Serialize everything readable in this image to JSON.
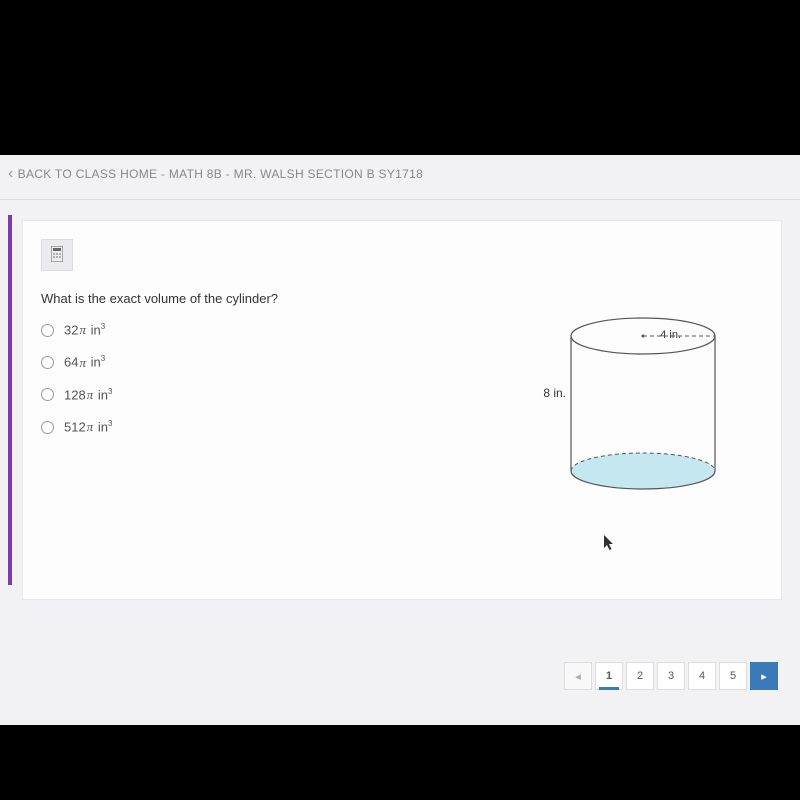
{
  "breadcrumb": {
    "label": "BACK TO CLASS HOME - MATH 8B - MR. WALSH SECTION B SY1718"
  },
  "calculator": {
    "icon": "🖩"
  },
  "question": {
    "text": "What is the exact volume of the cylinder?"
  },
  "options": [
    {
      "num": "32",
      "unit": "in"
    },
    {
      "num": "64",
      "unit": "in"
    },
    {
      "num": "128",
      "unit": "in"
    },
    {
      "num": "512",
      "unit": "in"
    }
  ],
  "diagram": {
    "height_label": "8 in.",
    "radius_label": "4 in."
  },
  "pagination": {
    "prev": "◂",
    "pages": [
      "1",
      "2",
      "3",
      "4",
      "5"
    ],
    "next": "▸",
    "active": "1"
  },
  "chart_data": {
    "type": "diagram",
    "shape": "cylinder",
    "radius": 4,
    "height": 8,
    "unit": "in"
  }
}
